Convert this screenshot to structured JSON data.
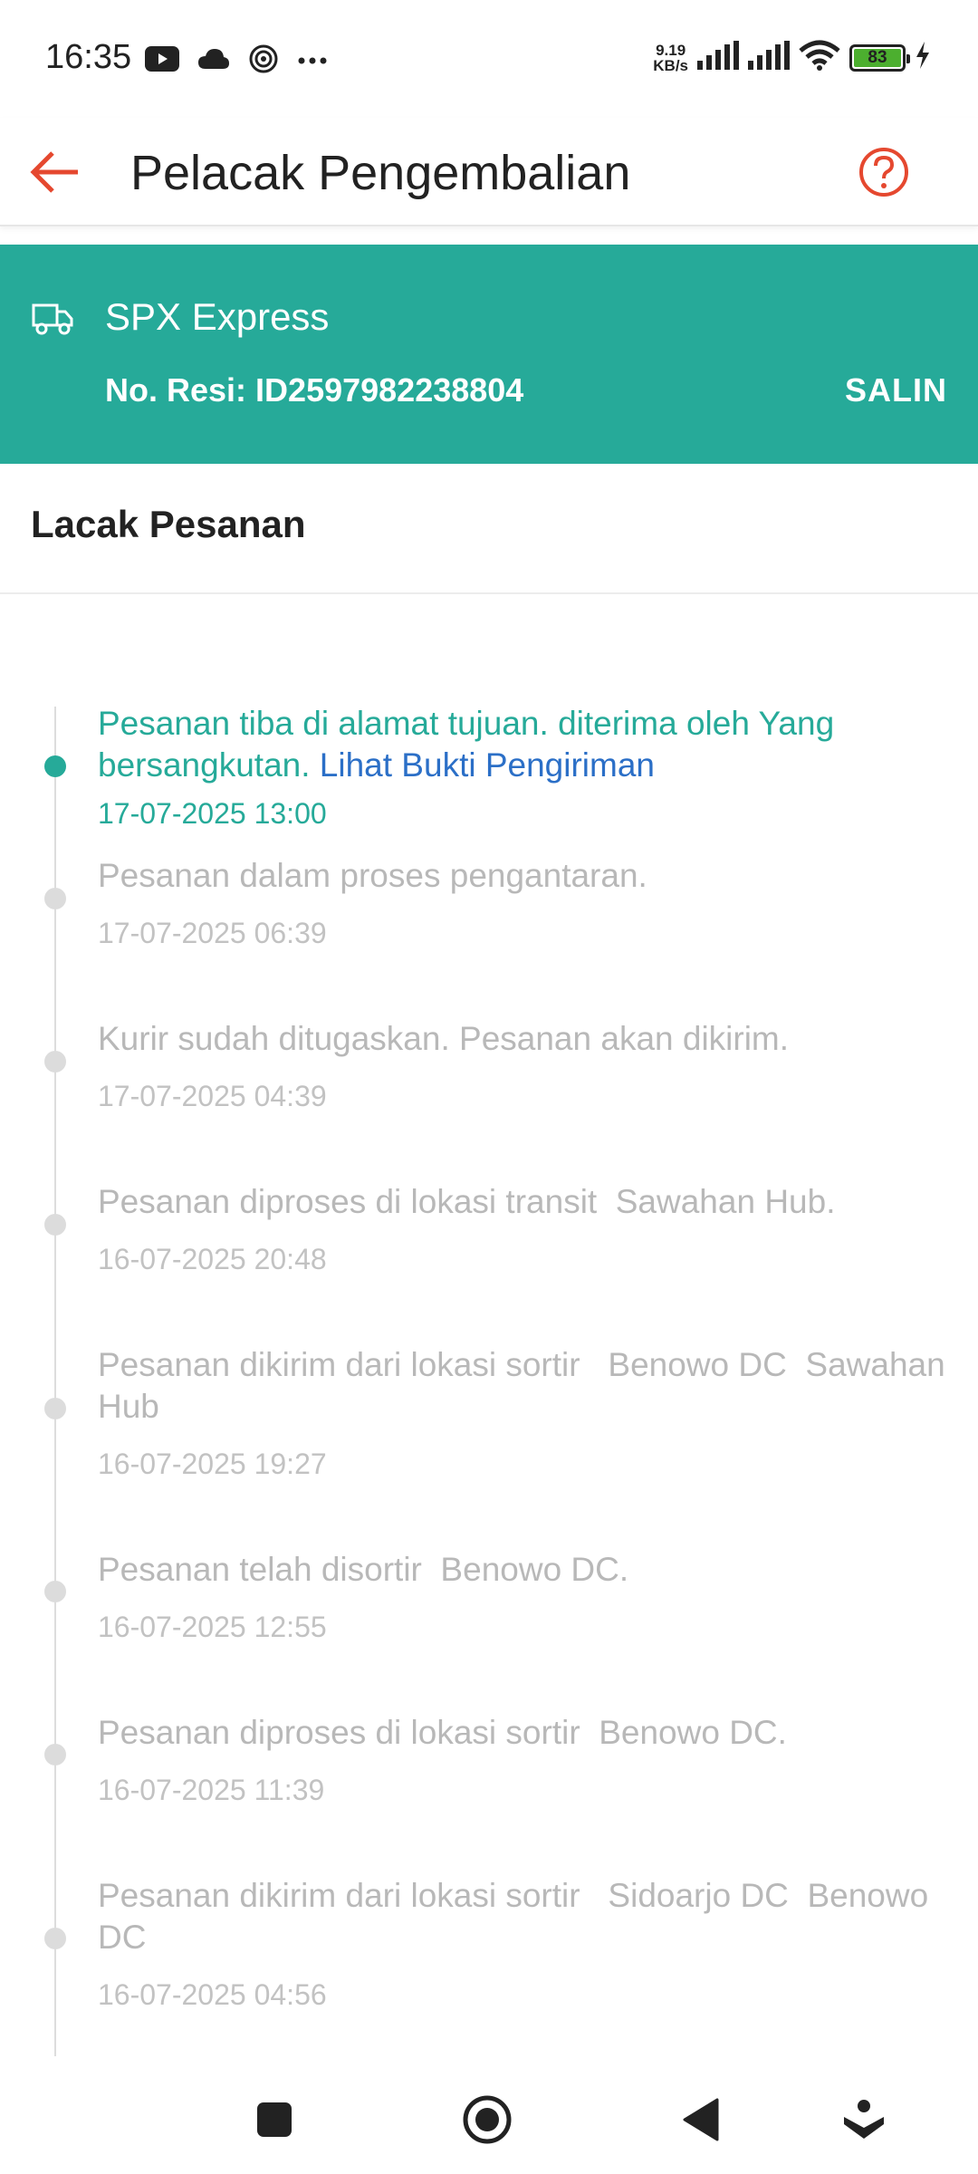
{
  "status_bar": {
    "time": "16:35",
    "left_icons": [
      "youtube-icon",
      "cloud-icon",
      "spiral-icon",
      "more-dots-icon"
    ],
    "net_speed": "9.19",
    "net_speed_unit": "KB/s",
    "battery": "83",
    "battery_color": "#4caf2f"
  },
  "header": {
    "title": "Pelacak Pengembalian",
    "accent_color": "#e5482f"
  },
  "courier": {
    "name": "SPX Express",
    "resi_label": "No. Resi:",
    "resi_number": "ID2597982238804",
    "copy_label": "SALIN",
    "bg_color": "#26aa99"
  },
  "section_title": "Lacak Pesanan",
  "timeline": [
    {
      "text": "Pesanan tiba di alamat tujuan. diterima oleh Yang bersangkutan.",
      "link": "Lihat Bukti Pengiriman",
      "time": "17-07-2025 13:00",
      "active": true
    },
    {
      "text": "Pesanan dalam proses pengantaran.",
      "time": "17-07-2025 06:39"
    },
    {
      "text": "Kurir sudah ditugaskan. Pesanan akan dikirim.",
      "time": "17-07-2025 04:39"
    },
    {
      "text": "Pesanan diproses di lokasi transit  Sawahan Hub.",
      "time": "16-07-2025 20:48"
    },
    {
      "text": "Pesanan dikirim dari lokasi sortir   Benowo DC  Sawahan Hub",
      "time": "16-07-2025 19:27"
    },
    {
      "text": "Pesanan telah disortir  Benowo DC.",
      "time": "16-07-2025 12:55"
    },
    {
      "text": "Pesanan diproses di lokasi sortir  Benowo DC.",
      "time": "16-07-2025 11:39"
    },
    {
      "text": "Pesanan dikirim dari lokasi sortir   Sidoarjo DC  Benowo DC",
      "time": "16-07-2025 04:56"
    }
  ],
  "nav_bar": [
    "recents-square-icon",
    "home-circle-icon",
    "back-triangle-icon",
    "assistant-icon"
  ]
}
